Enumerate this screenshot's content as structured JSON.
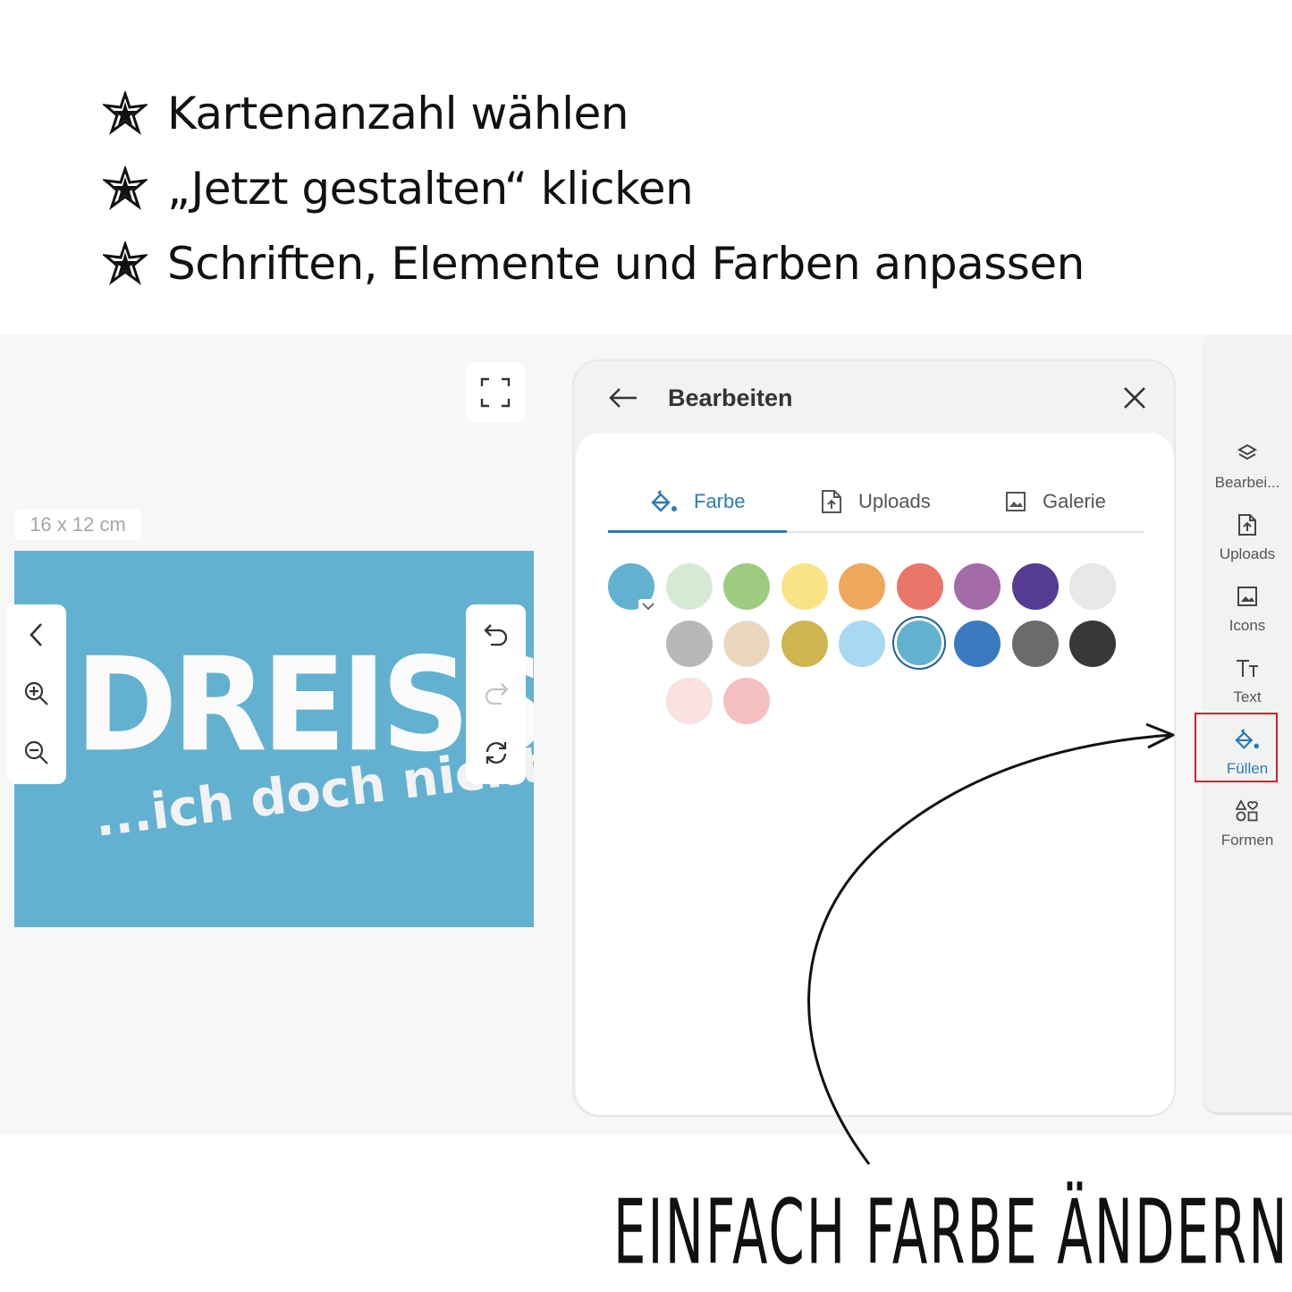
{
  "instructions": [
    "Kartenanzahl wählen",
    "„Jetzt gestalten“ klicken",
    "Schriften, Elemente und Farben anpassen"
  ],
  "canvas": {
    "size_label": "16 x 12 cm",
    "card_title": "DREISS",
    "card_subtitle": "...ich doch nicht!",
    "card_color": "#63b1d1"
  },
  "panel": {
    "title": "Bearbeiten",
    "tabs": [
      {
        "label": "Farbe",
        "icon": "paint-bucket-icon",
        "active": true
      },
      {
        "label": "Uploads",
        "icon": "upload-file-icon",
        "active": false
      },
      {
        "label": "Galerie",
        "icon": "image-icon",
        "active": false
      }
    ],
    "swatch_rows": [
      [
        "#63b1d1",
        "#d5ead2",
        "#9dcc80",
        "#f8e487",
        "#efa75e",
        "#ea7569",
        "#a46ba9",
        "#563b92",
        "#e8e8e8"
      ],
      [
        "#b8b8b8",
        "#e9d6bd",
        "#cfb450",
        "#a8d9f0",
        "#63b1d1",
        "#3a7bbf",
        "#6b6b6b",
        "#383838"
      ],
      [
        "#fbe1e0",
        "#f5c0bf"
      ]
    ],
    "selected_swatch": "#63b1d1"
  },
  "sidebar": {
    "items": [
      {
        "label": "Bearbei...",
        "icon": "layers-icon"
      },
      {
        "label": "Uploads",
        "icon": "upload-file-icon"
      },
      {
        "label": "Icons",
        "icon": "image-icon"
      },
      {
        "label": "Text",
        "icon": "text-icon"
      },
      {
        "label": "Füllen",
        "icon": "paint-bucket-icon",
        "active": true
      },
      {
        "label": "Formen",
        "icon": "shapes-icon"
      }
    ]
  },
  "note": "EINFACH FARBE ÄNDERN!",
  "colors": {
    "accent": "#2b7cb5",
    "highlight": "#d3222a"
  }
}
